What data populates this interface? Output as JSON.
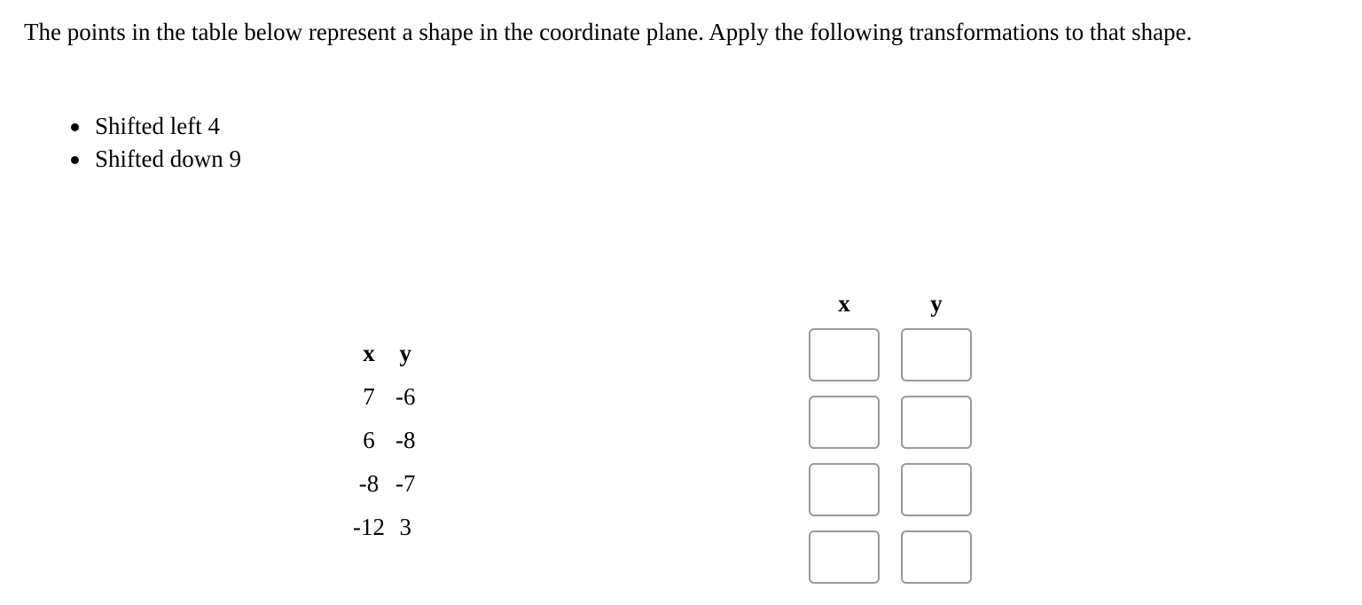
{
  "question": {
    "prompt": "The points in the table below represent a shape in the coordinate plane. Apply the following transformations to that shape.",
    "transformations": [
      "Shifted left 4",
      "Shifted down 9"
    ]
  },
  "given_table": {
    "headers": [
      "x",
      "y"
    ],
    "rows": [
      [
        "7",
        "-6"
      ],
      [
        "6",
        "-8"
      ],
      [
        "-8",
        "-7"
      ],
      [
        "-12",
        "3"
      ]
    ]
  },
  "answer_table": {
    "headers": [
      "x",
      "y"
    ],
    "rows": [
      {
        "x": "",
        "y": ""
      },
      {
        "x": "",
        "y": ""
      },
      {
        "x": "",
        "y": ""
      },
      {
        "x": "",
        "y": ""
      }
    ]
  }
}
